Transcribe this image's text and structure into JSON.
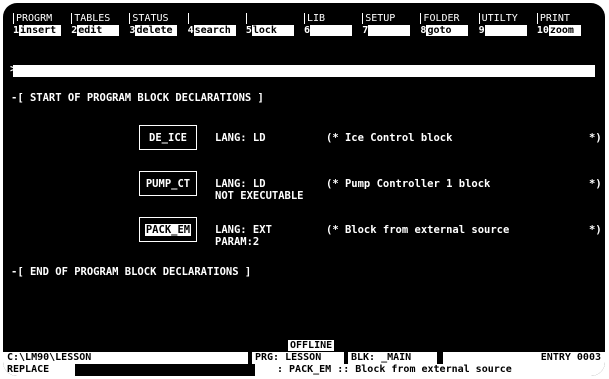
{
  "function_keys": {
    "categories": [
      {
        "label": "PROGRM"
      },
      {
        "label": "TABLES"
      },
      {
        "label": "STATUS"
      },
      {
        "label": ""
      },
      {
        "label": ""
      },
      {
        "label": "LIB"
      },
      {
        "label": "SETUP"
      },
      {
        "label": "FOLDER"
      },
      {
        "label": "UTILTY"
      },
      {
        "label": "PRINT"
      }
    ],
    "keys": [
      {
        "num": "1",
        "label": "insert"
      },
      {
        "num": "2",
        "label": "edit"
      },
      {
        "num": "3",
        "label": "delete"
      },
      {
        "num": "4",
        "label": "search"
      },
      {
        "num": "5",
        "label": "lock"
      },
      {
        "num": "6",
        "label": ""
      },
      {
        "num": "7",
        "label": ""
      },
      {
        "num": "8",
        "label": "goto"
      },
      {
        "num": "9",
        "label": ""
      },
      {
        "num": "10",
        "label": "zoom"
      }
    ]
  },
  "command": {
    "prompt": ">",
    "value": ""
  },
  "declarations": {
    "start": "-[ START OF PROGRAM BLOCK DECLARATIONS ]",
    "end": "-[  END OF PROGRAM BLOCK DECLARATIONS  ]",
    "blocks": [
      {
        "name": "DE_ICE",
        "lang": "LANG: LD",
        "extra": "",
        "comment": "(* Ice Control block",
        "close": "*)"
      },
      {
        "name": "PUMP_CT",
        "lang": "LANG: LD",
        "extra": "NOT EXECUTABLE",
        "comment": "(* Pump Controller 1 block",
        "close": "*)"
      },
      {
        "name": "PACK_EM",
        "lang": "LANG: EXT",
        "extra": "PARAM:2",
        "comment": "(* Block from external source",
        "close": "*)"
      }
    ]
  },
  "status": {
    "mode": "OFFLINE",
    "path": "C:\\LM90\\LESSON",
    "program": "PRG: LESSON",
    "block": "BLK: _MAIN",
    "entry": "ENTRY 0003",
    "edit_mode": "REPLACE",
    "message": ": PACK_EM :: Block from external source"
  }
}
